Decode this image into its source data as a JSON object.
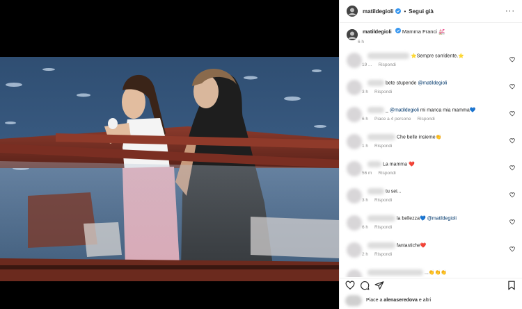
{
  "header": {
    "username": "matildegioli",
    "separator": "•",
    "follow_label": "Segui già",
    "more": "···"
  },
  "caption": {
    "username": "matildegioli",
    "text": "Mamma Franci 💒",
    "time": "6 h"
  },
  "comments": [
    {
      "text": "⭐Sempre sorridente.⭐",
      "time": "19 ...",
      "reply": "Rispondi",
      "likes": ""
    },
    {
      "text": "bete stupende",
      "mention": "@matildegioli",
      "time": "3 h",
      "reply": "Rispondi",
      "likes": ""
    },
    {
      "text": "_",
      "mention": "@matildegioli",
      "after": " mi manca mia mamma💙",
      "time": "6 h",
      "reply": "Rispondi",
      "likes": "Piace a 4 persone"
    },
    {
      "text": "Che belle insieme👏",
      "time": "1 h",
      "reply": "Rispondi",
      "likes": ""
    },
    {
      "text": "La mamma ❤️",
      "time": "56 m",
      "reply": "Rispondi",
      "likes": ""
    },
    {
      "text": "tu sei...",
      "time": "3 h",
      "reply": "Rispondi",
      "likes": ""
    },
    {
      "text": "la bellezza💙 ",
      "mention": "@matildegioli",
      "time": "6 h",
      "reply": "Rispondi",
      "likes": ""
    },
    {
      "text": "fantastiche❤️",
      "time": "2 h",
      "reply": "Rispondi",
      "likes": ""
    },
    {
      "text": "...👏👏👏",
      "time": "",
      "reply": "",
      "likes": ""
    }
  ],
  "likes": {
    "prefix": "Piace a ",
    "user": "alenaseredova",
    "suffix": " e altri"
  },
  "colors": {
    "mention": "#00376b",
    "verified": "#3897f0",
    "meta": "#8e8e8e"
  }
}
